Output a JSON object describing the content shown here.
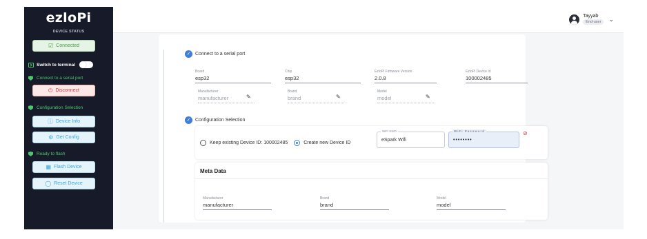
{
  "sidebar": {
    "logo": "ezloPi",
    "device_status_label": "DEVICE STATUS",
    "connected_label": "Connected",
    "switch_terminal_label": "Switch to terminal",
    "connect_serial_label": "Connect to a serial port",
    "disconnect_label": "Disconnect",
    "config_selection_label": "Configuration Selection",
    "device_info_label": "Device Info",
    "get_config_label": "Get Config",
    "ready_flash_label": "Ready to flash",
    "flash_device_label": "Flash Device",
    "reset_device_label": "Reset Device",
    "terminal_toggle_on": false
  },
  "user": {
    "name": "Tayyab",
    "role": "End-user"
  },
  "steps": {
    "connect_title": "Connect to a serial port",
    "config_title": "Configuration Selection"
  },
  "serial": {
    "board_label": "Board",
    "board_value": "esp32",
    "chip_label": "Chip",
    "chip_value": "esp32",
    "firmware_label": "EzloPi Firmware Version",
    "firmware_value": "2.0.8",
    "device_id_label": "EzloPi Device Id",
    "device_id_value": "100002485",
    "manufacturer_label": "Manufacturer",
    "manufacturer_placeholder": "manufacturer",
    "brand_label": "Brand",
    "brand_placeholder": "brand",
    "model_label": "Model",
    "model_placeholder": "model"
  },
  "config": {
    "keep_existing_label": "Keep existing Device ID: 100002485",
    "create_new_label": "Create new Device ID",
    "selected_option": "create_new",
    "wifi_ssid_label": "WiFi SSID",
    "wifi_ssid_value": "eSpark Wifi",
    "wifi_password_label": "WiFi Password",
    "wifi_password_value": "••••••••"
  },
  "meta": {
    "title": "Meta Data",
    "manufacturer_label": "Manufacturer",
    "manufacturer_value": "manufacturer",
    "brand_label": "Brand",
    "brand_value": "brand",
    "model_label": "Model",
    "model_value": "model"
  },
  "colors": {
    "sidebar_bg": "#171b29",
    "accent_blue": "#3f7de0",
    "status_green": "#4dc56a",
    "danger_red": "#d83a3a"
  }
}
